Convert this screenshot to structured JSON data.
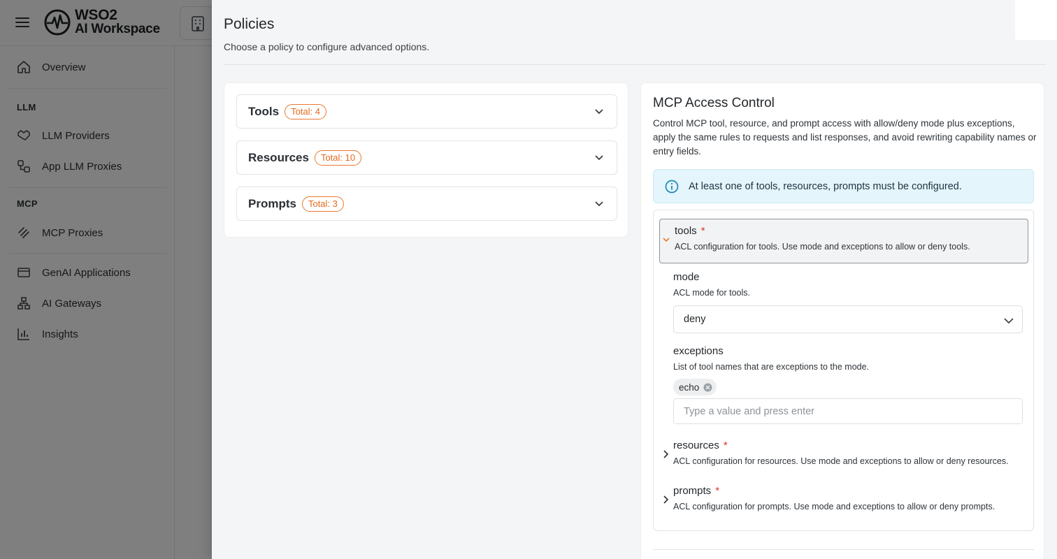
{
  "app": {
    "brand_line1": "WSO2",
    "brand_line2": "AI Workspace"
  },
  "sidebar": {
    "overview": "Overview",
    "section_llm": "LLM",
    "llm_providers": "LLM Providers",
    "app_llm_proxies": "App LLM Proxies",
    "section_mcp": "MCP",
    "mcp_proxies": "MCP Proxies",
    "genai_applications": "GenAI Applications",
    "ai_gateways": "AI Gateways",
    "insights": "Insights"
  },
  "drawer": {
    "title": "Policies",
    "subtitle": "Choose a policy to configure advanced options.",
    "categories": [
      {
        "label": "Tools",
        "badge": "Total: 4"
      },
      {
        "label": "Resources",
        "badge": "Total: 10"
      },
      {
        "label": "Prompts",
        "badge": "Total: 3"
      }
    ]
  },
  "policy": {
    "title": "MCP Access Control",
    "description": "Control MCP tool, resource, and prompt access with allow/deny mode plus exceptions, apply the same rules to requests and list responses, and avoid rewriting capability names or entry fields.",
    "info": "At least one of tools, resources, prompts must be configured.",
    "tools": {
      "label": "tools",
      "required_mark": "*",
      "help": "ACL configuration for tools. Use mode and exceptions to allow or deny tools.",
      "mode_label": "mode",
      "mode_help": "ACL mode for tools.",
      "mode_value": "deny",
      "exceptions_label": "exceptions",
      "exceptions_help": "List of tool names that are exceptions to the mode.",
      "exceptions": [
        "echo"
      ],
      "exceptions_placeholder": "Type a value and press enter"
    },
    "resources": {
      "label": "resources",
      "required_mark": "*",
      "help": "ACL configuration for resources. Use mode and exceptions to allow or deny resources."
    },
    "prompts": {
      "label": "prompts",
      "required_mark": "*",
      "help": "ACL configuration for prompts. Use mode and exceptions to allow or deny prompts."
    }
  },
  "colors": {
    "accent_orange": "#e8792e",
    "info_bg": "#e4f5fb",
    "required_red": "#d9342b"
  }
}
